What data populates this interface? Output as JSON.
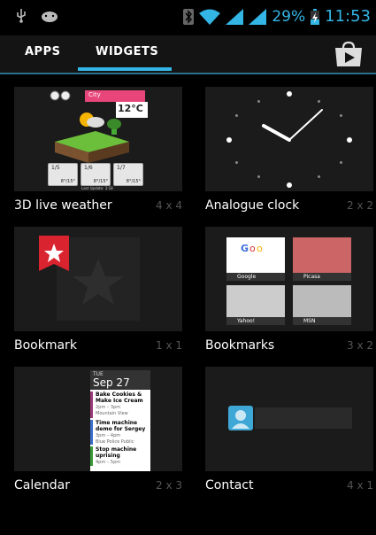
{
  "status_bar": {
    "battery_percent": "29%",
    "time": "11:53"
  },
  "tabs": [
    {
      "label": "APPS",
      "selected": false
    },
    {
      "label": "WIDGETS",
      "selected": true
    }
  ],
  "widgets": [
    {
      "name": "3D live weather",
      "size": "4 x 4",
      "preview": {
        "city": "City",
        "temp": "12°C",
        "update": "Last Update: 3:18",
        "days": [
          "1/5",
          "1/6",
          "1/7"
        ],
        "hilo": [
          "8°/15°",
          "8°/15°",
          "8°/15°"
        ]
      }
    },
    {
      "name": "Analogue clock",
      "size": "2 x 2"
    },
    {
      "name": "Bookmark",
      "size": "1 x 1"
    },
    {
      "name": "Bookmarks",
      "size": "3 x 2",
      "preview": {
        "items": [
          "Google",
          "Picasa",
          "Yahoo!",
          "MSN"
        ]
      }
    },
    {
      "name": "Calendar",
      "size": "2 x 3",
      "preview": {
        "dow": "TUE",
        "date": "Sep 27",
        "events": [
          {
            "title": "Bake Cookies & Make Ice Cream",
            "time": "2pm – 3pm",
            "place": "Mountain View"
          },
          {
            "title": "Time machine demo for Sergey",
            "time": "3pm – 4pm",
            "place": "Blue Police Public"
          },
          {
            "title": "Stop machine uprising",
            "time": "4pm – 5pm",
            "place": ""
          }
        ]
      }
    },
    {
      "name": "Contact",
      "size": "4 x 1"
    }
  ],
  "colors": {
    "accent": "#33b5e5",
    "thumb_bg": "#1b1b1b",
    "tab_bar": "#141414"
  }
}
